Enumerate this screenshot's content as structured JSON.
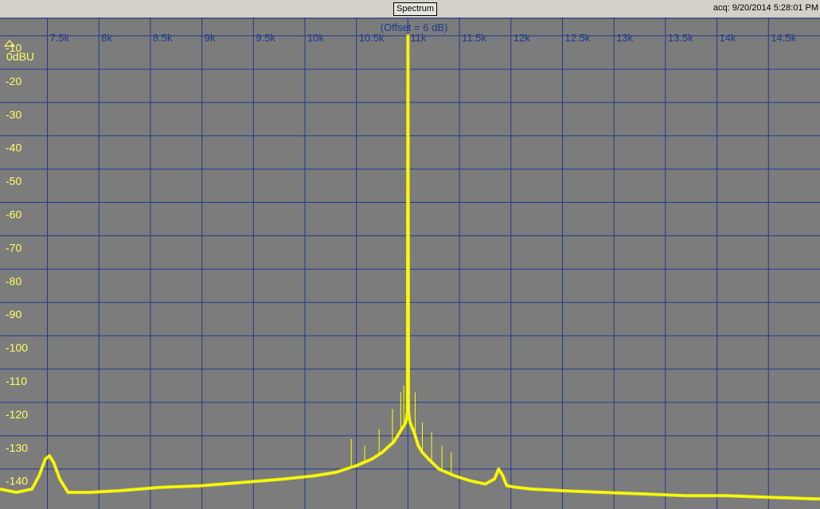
{
  "window": {
    "tab_label": "Spectrum",
    "acquired_text": "acq: 9/20/2014 5:28:01 PM"
  },
  "colors": {
    "background": "#7c7c7c",
    "grid": "#1f3a8f",
    "trace": "#ffff00",
    "y_labels": "#ffff66",
    "x_labels": "#1c3a8c"
  },
  "chart_data": {
    "type": "line",
    "title": "",
    "annotation": "(Offset = 6 dB)",
    "ylabel": "0dBU",
    "x_unit": "Hz",
    "xlim": [
      7040,
      15000
    ],
    "ylim": [
      -152,
      -4.5
    ],
    "x_ticks": [
      {
        "value": 7500,
        "label": "7.5k"
      },
      {
        "value": 8000,
        "label": "8k"
      },
      {
        "value": 8500,
        "label": "8.5k"
      },
      {
        "value": 9000,
        "label": "9k"
      },
      {
        "value": 9500,
        "label": "9.5k"
      },
      {
        "value": 10000,
        "label": "10k"
      },
      {
        "value": 10500,
        "label": "10.5k"
      },
      {
        "value": 11000,
        "label": "11k"
      },
      {
        "value": 11500,
        "label": "11.5k"
      },
      {
        "value": 12000,
        "label": "12k"
      },
      {
        "value": 12500,
        "label": "12.5k"
      },
      {
        "value": 13000,
        "label": "13k"
      },
      {
        "value": 13500,
        "label": "13.5k"
      },
      {
        "value": 14000,
        "label": "14k"
      },
      {
        "value": 14500,
        "label": "14.5k"
      }
    ],
    "y_ticks": [
      {
        "value": -10,
        "label": "-10"
      },
      {
        "value": -20,
        "label": "-20"
      },
      {
        "value": -30,
        "label": "-30"
      },
      {
        "value": -40,
        "label": "-40"
      },
      {
        "value": -50,
        "label": "-50"
      },
      {
        "value": -60,
        "label": "-60"
      },
      {
        "value": -70,
        "label": "-70"
      },
      {
        "value": -80,
        "label": "-80"
      },
      {
        "value": -90,
        "label": "-90"
      },
      {
        "value": -100,
        "label": "-100"
      },
      {
        "value": -110,
        "label": "-110"
      },
      {
        "value": -120,
        "label": "-120"
      },
      {
        "value": -130,
        "label": "-130"
      },
      {
        "value": -140,
        "label": "-140"
      }
    ],
    "grid": true,
    "series": [
      {
        "color": "#ffff00",
        "x": [
          7040,
          7200,
          7350,
          7420,
          7480,
          7520,
          7560,
          7620,
          7700,
          7900,
          8200,
          8600,
          9000,
          9400,
          9800,
          10100,
          10300,
          10500,
          10650,
          10750,
          10820,
          10860,
          10880,
          10900,
          10920,
          10940,
          10960,
          10980,
          10990,
          10995,
          11000,
          11005,
          11010,
          11020,
          11040,
          11060,
          11080,
          11100,
          11140,
          11200,
          11300,
          11450,
          11600,
          11750,
          11840,
          11880,
          11920,
          11960,
          12050,
          12200,
          12500,
          12900,
          13300,
          13700,
          14100,
          14500,
          15000
        ],
        "values": [
          -146,
          -147,
          -146,
          -142,
          -137,
          -136,
          -138,
          -143,
          -147,
          -147,
          -146.5,
          -145.5,
          -145,
          -144,
          -143,
          -142,
          -141,
          -139,
          -137,
          -135,
          -133,
          -132,
          -131,
          -130,
          -129,
          -128,
          -127,
          -126,
          -124,
          -123,
          -10,
          -123,
          -124,
          -126,
          -127.5,
          -129,
          -131,
          -133,
          -135,
          -137,
          -140,
          -142,
          -143.5,
          -144.5,
          -143,
          -140,
          -142,
          -145,
          -145.5,
          -146,
          -146.5,
          -147,
          -147.5,
          -148,
          -148,
          -148.5,
          -149
        ]
      }
    ],
    "spurs": {
      "x": [
        10450,
        10580,
        10720,
        10850,
        10930,
        10960,
        11070,
        11140,
        11230,
        11330,
        11420
      ],
      "values": [
        -131,
        -133,
        -128,
        -122,
        -117,
        -115,
        -117,
        -126,
        -129,
        -133,
        -135
      ]
    }
  }
}
